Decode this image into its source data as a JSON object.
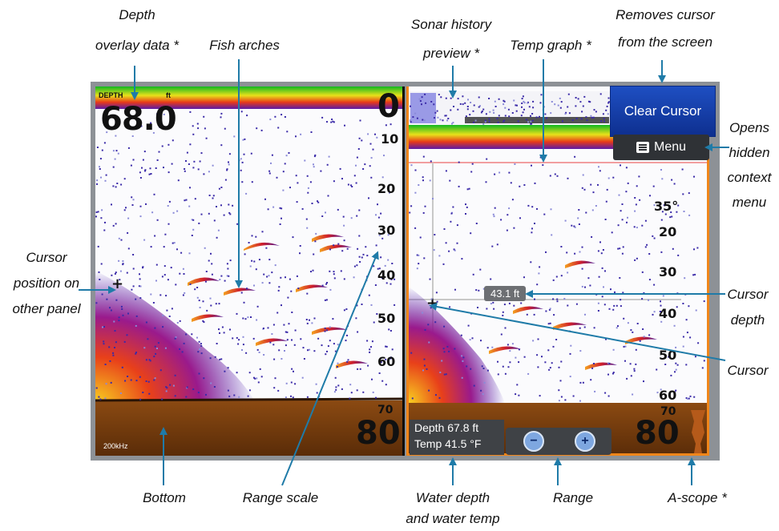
{
  "callouts": {
    "depth_overlay_line1": "Depth",
    "depth_overlay_line2": "overlay data *",
    "fish_arches": "Fish arches",
    "sonar_history_line1": "Sonar history",
    "sonar_history_line2": "preview *",
    "temp_graph": "Temp graph *",
    "removes_cursor_line1": "Removes cursor",
    "removes_cursor_line2": "from the screen",
    "opens_menu_line1": "Opens",
    "opens_menu_line2": "hidden",
    "opens_menu_line3": "context",
    "opens_menu_line4": "menu",
    "cursor_other_line1": "Cursor",
    "cursor_other_line2": "position on",
    "cursor_other_line3": "other panel",
    "cursor_depth_line1": "Cursor",
    "cursor_depth_line2": "depth",
    "cursor": "Cursor",
    "bottom": "Bottom",
    "range_scale": "Range scale",
    "water_line1": "Water depth",
    "water_line2": "and water temp",
    "range": "Range",
    "ascope": "A-scope *"
  },
  "left_panel": {
    "depth_label": "DEPTH",
    "depth_unit": "ft",
    "depth_value": "68.0",
    "range_top": "0",
    "ticks": [
      "10",
      "20",
      "30",
      "40",
      "50",
      "60",
      "70"
    ],
    "range_bottom": "80",
    "frequency": "200kHz"
  },
  "right_panel": {
    "temp_tick": "35°",
    "ticks": [
      "20",
      "30",
      "40",
      "50",
      "60",
      "70"
    ],
    "range_bottom": "80",
    "cursor_depth": "43.1 ft",
    "water_depth": "Depth 67.8  ft",
    "water_temp": "Temp  41.5 °F"
  },
  "buttons": {
    "clear_cursor": "Clear Cursor",
    "menu": "Menu",
    "zoom_out": "−",
    "zoom_in": "+"
  },
  "colors": {
    "panel_border": "#f0861a",
    "clear_cursor_bg": "#1e4fc2",
    "callout_arrow": "#1f7ba8"
  }
}
